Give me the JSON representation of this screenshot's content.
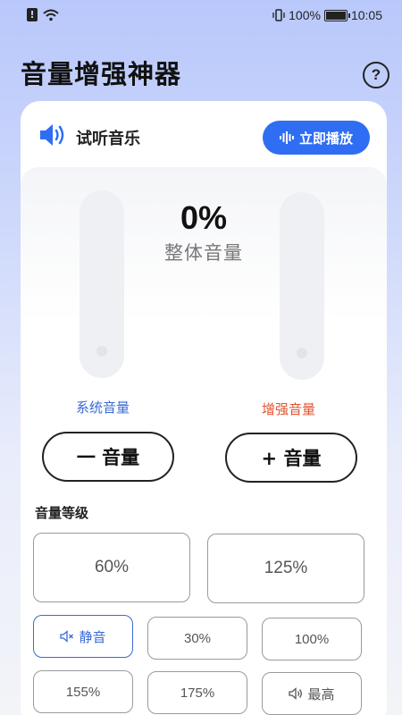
{
  "status_bar": {
    "alert_glyph": "!",
    "battery_percent": "100%",
    "time": "10:05",
    "battery_level": 1.0,
    "icons": [
      "alert-icon",
      "wifi-icon",
      "vibrate-icon",
      "battery-charging-icon"
    ]
  },
  "header": {
    "title": "音量增强神器",
    "help_glyph": "?"
  },
  "preview": {
    "label": "试听音乐",
    "play_button": "立即播放"
  },
  "meter": {
    "overall_value": "0%",
    "overall_label": "整体音量",
    "system_label": "系统音量",
    "boost_label": "增强音量",
    "system_level": 0,
    "boost_level": 0
  },
  "controls": {
    "volume_down": "一 音量",
    "volume_up": "+ 音量"
  },
  "levels": {
    "title": "音量等级",
    "options": [
      "60%",
      "125%",
      "静音",
      "30%",
      "100%",
      "155%",
      "175%",
      "最高"
    ],
    "selected": "静音"
  },
  "colors": {
    "accent": "#2f6ef3",
    "system_label": "#3a6ad6",
    "boost_label": "#e2522e"
  }
}
